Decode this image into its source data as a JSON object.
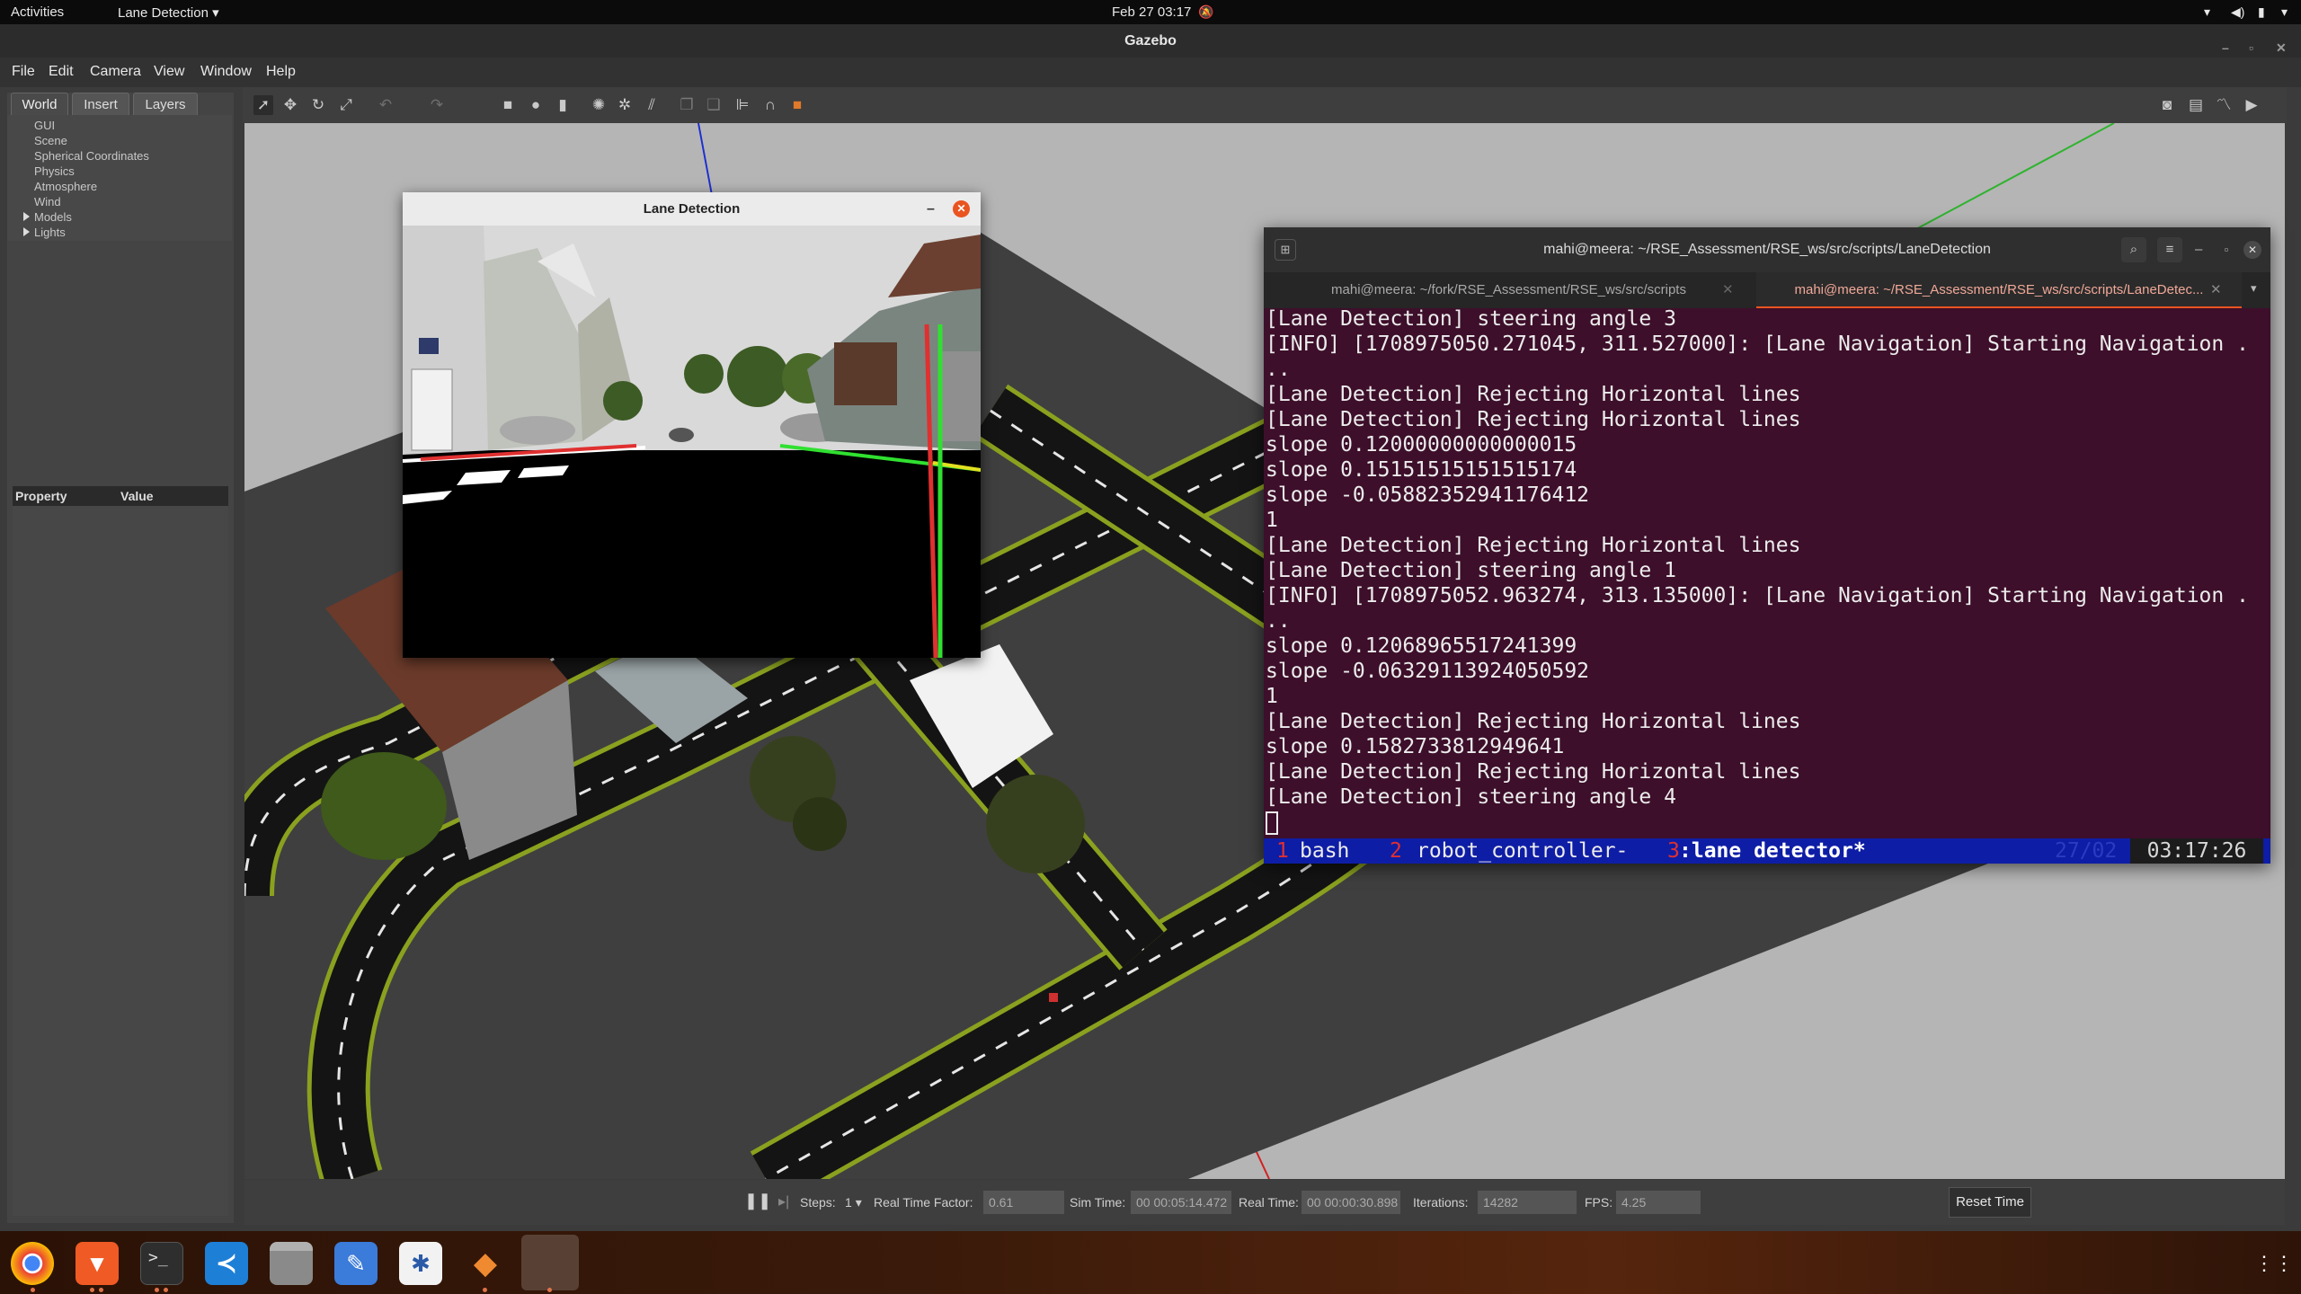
{
  "topbar": {
    "activities": "Activities",
    "app_menu": "Lane Detection",
    "datetime": "Feb 27  03:17"
  },
  "gazebo": {
    "title": "Gazebo",
    "menu": [
      "File",
      "Edit",
      "Camera",
      "View",
      "Window",
      "Help"
    ]
  },
  "left_panel": {
    "tabs": [
      "World",
      "Insert",
      "Layers"
    ],
    "tree": [
      "GUI",
      "Scene",
      "Spherical Coordinates",
      "Physics",
      "Atmosphere",
      "Wind",
      "Models",
      "Lights"
    ],
    "property_header": "Property",
    "value_header": "Value"
  },
  "lane_window": {
    "title": "Lane Detection"
  },
  "terminal": {
    "title": "mahi@meera: ~/RSE_Assessment/RSE_ws/src/scripts/LaneDetection",
    "tabs": [
      "mahi@meera: ~/fork/RSE_Assessment/RSE_ws/src/scripts",
      "mahi@meera: ~/RSE_Assessment/RSE_ws/src/scripts/LaneDetec..."
    ],
    "lines": [
      "[Lane Detection] steering angle 3",
      "[INFO] [1708975050.271045, 311.527000]: [Lane Navigation] Starting Navigation .",
      "..",
      "[Lane Detection] Rejecting Horizontal lines",
      "[Lane Detection] Rejecting Horizontal lines",
      "slope 0.12000000000000015",
      "slope 0.15151515151515174",
      "slope -0.05882352941176412",
      "1",
      "[Lane Detection] Rejecting Horizontal lines",
      "[Lane Detection] steering angle 1",
      "[INFO] [1708975052.963274, 313.135000]: [Lane Navigation] Starting Navigation .",
      "..",
      "slope 0.12068965517241399",
      "slope -0.06329113924050592",
      "1",
      "[Lane Detection] Rejecting Horizontal lines",
      "slope 0.1582733812949641",
      "[Lane Detection] Rejecting Horizontal lines",
      "[Lane Detection] steering angle 4"
    ],
    "tmux": {
      "w1_num": "1",
      "w1_name": "bash",
      "w2_num": "2",
      "w2_name": "robot_controller-",
      "w3_num": "3",
      "w3_name": ":lane detector*",
      "date": "27/02",
      "time": "03:17:26"
    }
  },
  "status": {
    "steps_label": "Steps:",
    "steps_value": "1",
    "rtf_label": "Real Time Factor:",
    "rtf_value": "0.61",
    "sim_label": "Sim Time:",
    "sim_value": "00 00:05:14.472",
    "real_label": "Real Time:",
    "real_value": "00 00:00:30.898",
    "iter_label": "Iterations:",
    "iter_value": "14282",
    "fps_label": "FPS:",
    "fps_value": "4.25",
    "reset_label": "Reset Time"
  },
  "dock": {
    "apps": [
      "chrome-icon",
      "brave-icon",
      "terminal-icon",
      "vscode-icon",
      "files-icon",
      "text-editor-icon",
      "gazebo-icon",
      "blender-icon",
      "lane-detection-window-icon"
    ]
  }
}
